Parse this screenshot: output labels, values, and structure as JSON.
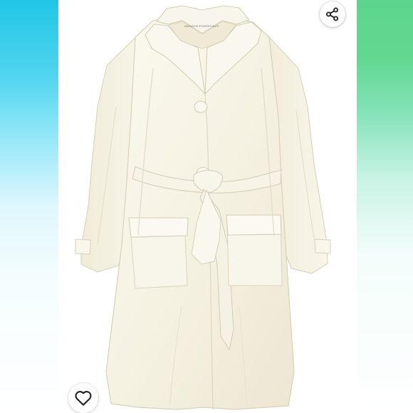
{
  "listing_photo": {
    "subject": "coat-photo",
    "label_text": "AMAZON ESSENTIALS"
  },
  "actions": {
    "share_icon": "share-icon",
    "like_icon": "heart-icon"
  },
  "colors": {
    "left_gradient_top": "#20c6e6",
    "right_gradient_top": "#5ed58f",
    "coat": "#f6f3e7",
    "coat_shadow": "#e6e1cf",
    "button_icon": "#222222"
  }
}
